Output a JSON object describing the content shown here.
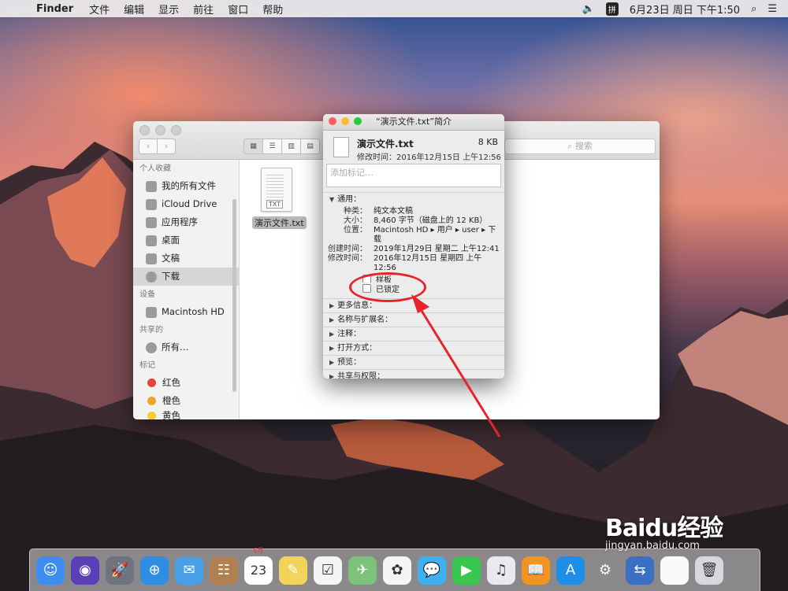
{
  "menubar": {
    "apple": "",
    "app": "Finder",
    "items": [
      "文件",
      "编辑",
      "显示",
      "前往",
      "窗口",
      "帮助"
    ],
    "volume": "🔈",
    "ime": "拼",
    "clock": "6月23日 周日 下午1:50",
    "search": "⌕",
    "list": "☰"
  },
  "finder": {
    "nav_back": "‹",
    "nav_forward": "›",
    "views": [
      "▦",
      "☰",
      "▥",
      "▤"
    ],
    "search_placeholder": "⌕ 搜索",
    "sidebar": {
      "favorites_header": "个人收藏",
      "favorites": [
        "我的所有文件",
        "iCloud Drive",
        "应用程序",
        "桌面",
        "文稿",
        "下载"
      ],
      "devices_header": "设备",
      "devices": [
        "Macintosh HD"
      ],
      "shared_header": "共享的",
      "shared": [
        "所有…"
      ],
      "tags_header": "标记",
      "tags": [
        {
          "label": "红色",
          "color": "#e8423a"
        },
        {
          "label": "橙色",
          "color": "#f2a12d"
        },
        {
          "label": "黄色",
          "color": "#f0d030"
        }
      ]
    },
    "file": {
      "name": "演示文件.txt",
      "badge": "TXT"
    }
  },
  "info": {
    "title": "“演示文件.txt”简介",
    "name": "演示文件.txt",
    "size": "8 KB",
    "modified": "修改时间：2016年12月15日 上午12:56",
    "tag_placeholder": "添加标记…",
    "general_header": "通用：",
    "fields": [
      {
        "k": "种类：",
        "v": "纯文本文稿"
      },
      {
        "k": "大小：",
        "v": "8,460 字节（磁盘上的 12 KB）"
      },
      {
        "k": "位置：",
        "v": "Macintosh HD ▸ 用户 ▸ user ▸ 下载"
      },
      {
        "k": "创建时间：",
        "v": "2019年1月29日 星期二 上午12:41"
      },
      {
        "k": "修改时间：",
        "v": "2016年12月15日 星期四 上午12:56"
      }
    ],
    "checkbox_stationery": "样板",
    "checkbox_locked": "已锁定",
    "sections": [
      "更多信息：",
      "名称与扩展名：",
      "注释：",
      "打开方式：",
      "预览：",
      "共享与权限："
    ]
  },
  "dock": {
    "icons": [
      {
        "name": "finder",
        "glyph": "☺",
        "color": "#3d8ef0"
      },
      {
        "name": "siri",
        "glyph": "◉",
        "color": "#5a3fb8"
      },
      {
        "name": "launchpad",
        "glyph": "🚀",
        "color": "#6d7480"
      },
      {
        "name": "safari",
        "glyph": "⊕",
        "color": "#2f8de4"
      },
      {
        "name": "mail",
        "glyph": "✉",
        "color": "#4aa0e6"
      },
      {
        "name": "contacts",
        "glyph": "☷",
        "color": "#b08050"
      },
      {
        "name": "calendar",
        "glyph": "23",
        "color": "#ffffff"
      },
      {
        "name": "notes",
        "glyph": "✎",
        "color": "#f3d45a"
      },
      {
        "name": "reminders",
        "glyph": "☑",
        "color": "#f5f5f5"
      },
      {
        "name": "maps",
        "glyph": "✈",
        "color": "#7cc27a"
      },
      {
        "name": "photos",
        "glyph": "✿",
        "color": "#f5f5f5"
      },
      {
        "name": "messages",
        "glyph": "💬",
        "color": "#3cb0f0"
      },
      {
        "name": "facetime",
        "glyph": "▶",
        "color": "#39c651"
      },
      {
        "name": "itunes",
        "glyph": "♫",
        "color": "#e9e9ef"
      },
      {
        "name": "ibooks",
        "glyph": "📖",
        "color": "#f29421"
      },
      {
        "name": "app-store",
        "glyph": "A",
        "color": "#1d8fe8"
      },
      {
        "name": "system-preferences",
        "glyph": "⚙",
        "color": "#8a8a8a"
      },
      {
        "name": "migration",
        "glyph": "⇆",
        "color": "#3a6fc4"
      },
      {
        "name": "document",
        "glyph": "",
        "color": "#fafafa"
      },
      {
        "name": "trash",
        "glyph": "🗑",
        "color": "#d8d8dc"
      }
    ]
  },
  "calendar_month": "6月",
  "watermark": {
    "brand": "Baidu经验",
    "url": "jingyan.baidu.com"
  }
}
